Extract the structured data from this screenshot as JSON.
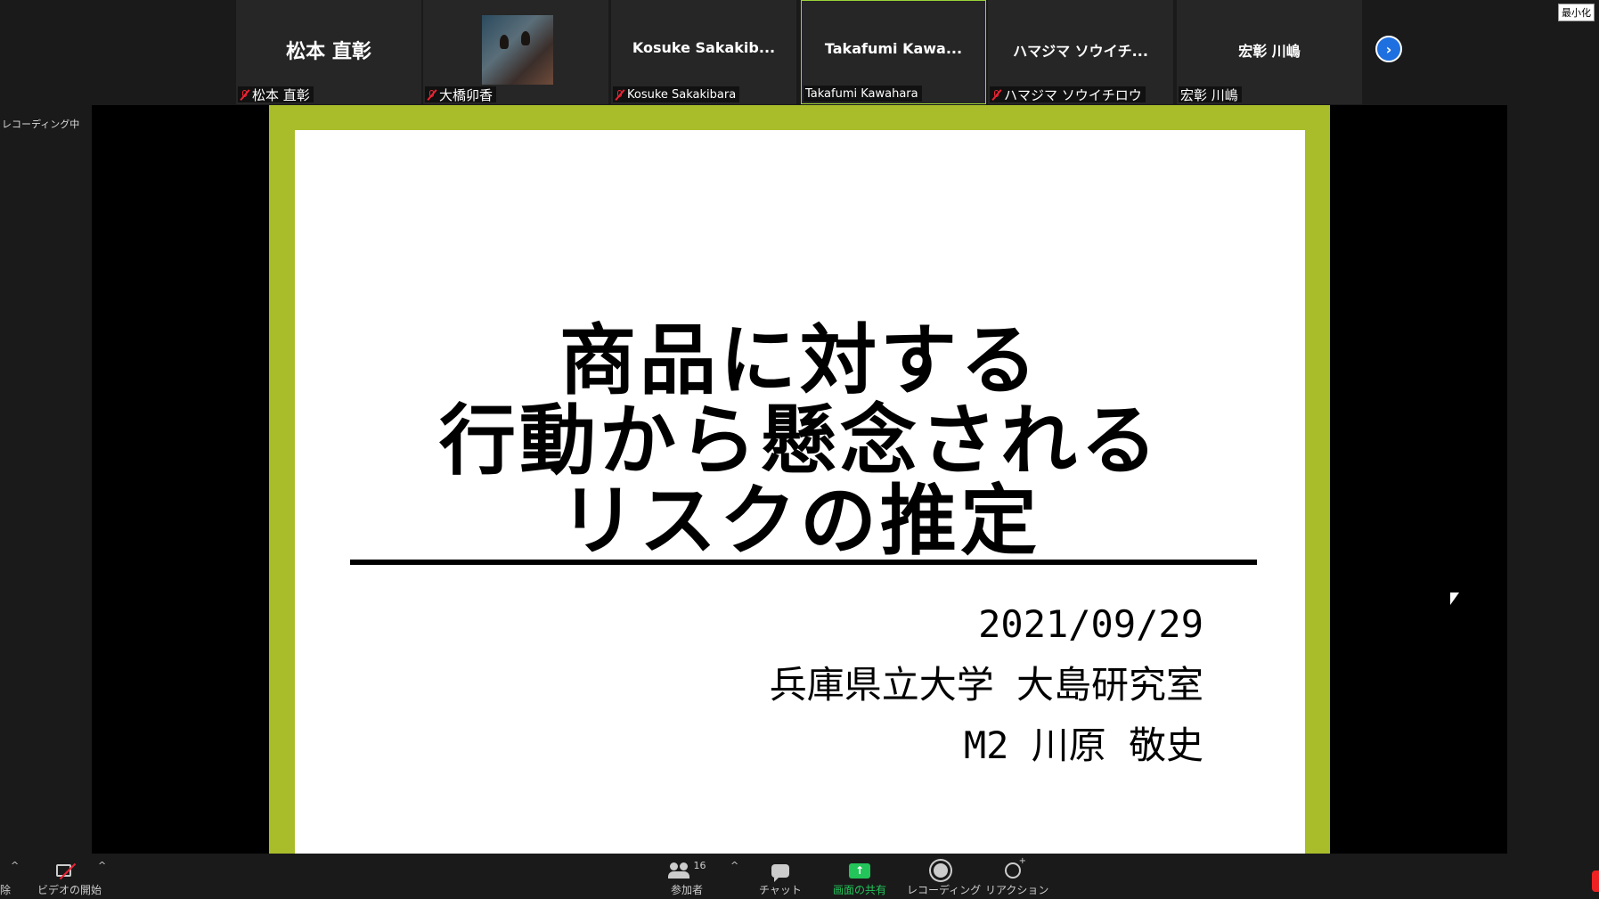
{
  "window": {
    "minimize_label": "最小化",
    "recording_label": "レコーディング中"
  },
  "participants": [
    {
      "display": "松本 直彰",
      "nametag": "松本 直彰",
      "muted": true,
      "photo": false
    },
    {
      "display": "",
      "nametag": "大橋卯香",
      "muted": true,
      "photo": true
    },
    {
      "display": "Kosuke  Sakakib...",
      "nametag": "Kosuke Sakakibara",
      "muted": true,
      "photo": false
    },
    {
      "display": "Takafumi  Kawa...",
      "nametag": "Takafumi Kawahara",
      "muted": false,
      "photo": false,
      "active": true
    },
    {
      "display": "ハマジマ  ソウイチ...",
      "nametag": "ハマジマ  ソウイチロウ",
      "muted": true,
      "photo": false
    },
    {
      "display": "宏彰 川嶋",
      "nametag": "宏彰 川嶋",
      "muted": false,
      "photo": false
    }
  ],
  "slide": {
    "title_lines": [
      "商品に対する",
      "行動から懸念される",
      "リスクの推定"
    ],
    "date": "2021/09/29",
    "affiliation": "兵庫県立大学 大島研究室",
    "author": "M2 川原 敬史"
  },
  "toolbar": {
    "left_cut_label": "除",
    "video_label": "ビデオの開始",
    "participants_label": "参加者",
    "participants_count": "16",
    "chat_label": "チャット",
    "share_label": "画面の共有",
    "record_label": "レコーディング",
    "reactions_label": "リアクション",
    "accent_share": "#23c45a"
  }
}
